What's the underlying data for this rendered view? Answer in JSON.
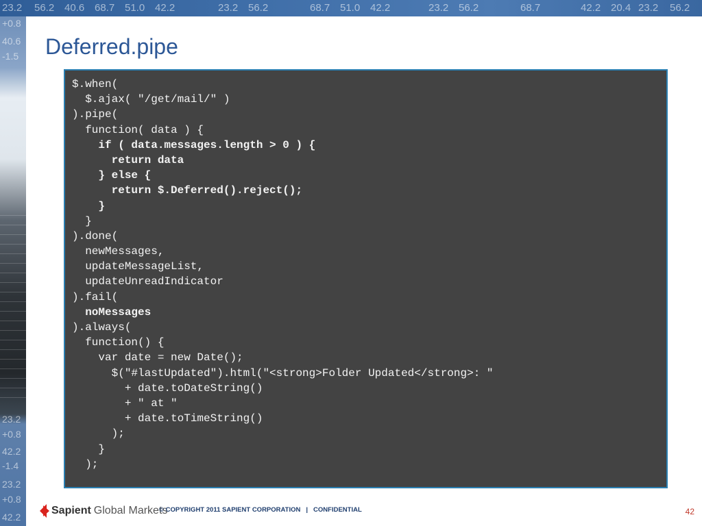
{
  "ticker_top": [
    "23.2",
    "56.2",
    "40.6",
    "68.7",
    "51.0",
    "42.2",
    "23.2",
    "56.2",
    "68.7",
    "51.0",
    "42.2",
    "23.2",
    "56.2",
    "68.7",
    "42.2",
    "20.4",
    "23.2",
    "56.2"
  ],
  "ticker_left": [
    "+0.8",
    "40.6",
    "-1.5",
    "23.2",
    "+0.8",
    "42.2",
    "-1.4",
    "23.2",
    "+0.8",
    "42.2"
  ],
  "slide": {
    "title": "Deferred.pipe",
    "code_lines": [
      {
        "text": "$.when(",
        "bold": false
      },
      {
        "text": "  $.ajax( \"/get/mail/\" )",
        "bold": false
      },
      {
        "text": ").pipe(",
        "bold": false
      },
      {
        "text": "  function( data ) {",
        "bold": false
      },
      {
        "text": "    if ( data.messages.length > 0 ) {",
        "bold": true
      },
      {
        "text": "      return data",
        "bold": true
      },
      {
        "text": "    } else {",
        "bold": true
      },
      {
        "text": "      return $.Deferred().reject();",
        "bold": true
      },
      {
        "text": "    }",
        "bold": true
      },
      {
        "text": "  }",
        "bold": false
      },
      {
        "text": ").done(",
        "bold": false
      },
      {
        "text": "  newMessages,",
        "bold": false
      },
      {
        "text": "  updateMessageList,",
        "bold": false
      },
      {
        "text": "  updateUnreadIndicator",
        "bold": false
      },
      {
        "text": ").fail(",
        "bold": false
      },
      {
        "text": "  noMessages",
        "bold": true
      },
      {
        "text": ").always(",
        "bold": false
      },
      {
        "text": "  function() {",
        "bold": false
      },
      {
        "text": "    var date = new Date();",
        "bold": false
      },
      {
        "text": "      $(\"#lastUpdated\").html(\"<strong>Folder Updated</strong>: \"",
        "bold": false
      },
      {
        "text": "        + date.toDateString()",
        "bold": false
      },
      {
        "text": "        + \" at \"",
        "bold": false
      },
      {
        "text": "        + date.toTimeString()",
        "bold": false
      },
      {
        "text": "      );",
        "bold": false
      },
      {
        "text": "    }",
        "bold": false
      },
      {
        "text": "  );",
        "bold": false
      }
    ]
  },
  "footer": {
    "logo_primary": "Sapient",
    "logo_secondary": "Global Markets",
    "copyright": "© COPYRIGHT 2011  SAPIENT CORPORATION",
    "separator": "|",
    "confidential": "CONFIDENTIAL",
    "page_number": "42"
  },
  "colors": {
    "title": "#2c5796",
    "code_background": "#434343",
    "code_border": "#2a7fb1",
    "logo_red": "#d9231d",
    "page_number": "#c0392b"
  }
}
